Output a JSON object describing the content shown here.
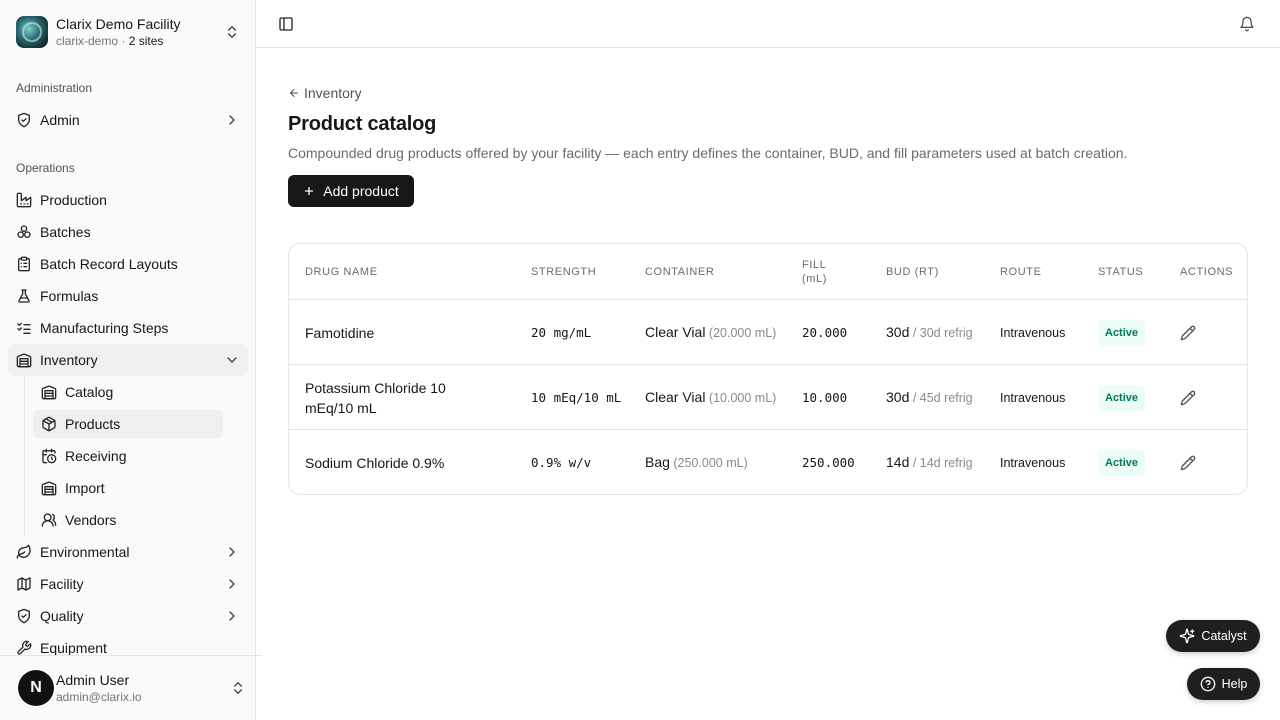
{
  "org": {
    "name": "Clarix Demo Facility",
    "slug": "clarix-demo",
    "separator": " · ",
    "sites": "2 sites"
  },
  "sidebar": {
    "administration_label": "Administration",
    "admin": "Admin",
    "operations_label": "Operations",
    "production": "Production",
    "batches": "Batches",
    "batch_record_layouts": "Batch Record Layouts",
    "formulas": "Formulas",
    "manufacturing_steps": "Manufacturing Steps",
    "inventory": "Inventory",
    "inventory_sub": {
      "catalog": "Catalog",
      "products": "Products",
      "receiving": "Receiving",
      "import": "Import",
      "vendors": "Vendors"
    },
    "environmental": "Environmental",
    "facility": "Facility",
    "quality": "Quality",
    "equipment": "Equipment"
  },
  "user": {
    "initial": "N",
    "name": "Admin User",
    "email": "admin@clarix.io"
  },
  "page": {
    "back_label": "Inventory",
    "title": "Product catalog",
    "description": "Compounded drug products offered by your facility — each entry defines the container, BUD, and fill parameters used at batch creation.",
    "add_button": "Add product"
  },
  "table": {
    "headers": {
      "drug_name": "Drug Name",
      "strength": "Strength",
      "container": "Container",
      "fill_line1": "Fill",
      "fill_line2": "(mL)",
      "bud": "BUD (RT)",
      "route": "Route",
      "status": "Status",
      "actions": "Actions"
    },
    "rows": [
      {
        "drug": "Famotidine",
        "strength": "20 mg/mL",
        "container": "Clear Vial",
        "container_vol": " (20.000 mL)",
        "fill": "20.000",
        "bud_rt": "30d",
        "bud_refrig": " / 30d refrig",
        "route": "Intravenous",
        "status": "Active"
      },
      {
        "drug": "Potassium Chloride 10 mEq/10 mL",
        "strength": "10 mEq/10 mL",
        "container": "Clear Vial",
        "container_vol": " (10.000 mL)",
        "fill": "10.000",
        "bud_rt": "30d",
        "bud_refrig": " / 45d refrig",
        "route": "Intravenous",
        "status": "Active"
      },
      {
        "drug": "Sodium Chloride 0.9%",
        "strength": "0.9% w/v",
        "container": "Bag",
        "container_vol": " (250.000 mL)",
        "fill": "250.000",
        "bud_rt": "14d",
        "bud_refrig": " / 14d refrig",
        "route": "Intravenous",
        "status": "Active"
      }
    ]
  },
  "floating": {
    "catalyst": "Catalyst",
    "help": "Help"
  },
  "colors": {
    "primary": "#171717",
    "active_badge_bg": "#ecfdf5",
    "active_badge_text": "#047857",
    "border": "#e5e5e5"
  }
}
